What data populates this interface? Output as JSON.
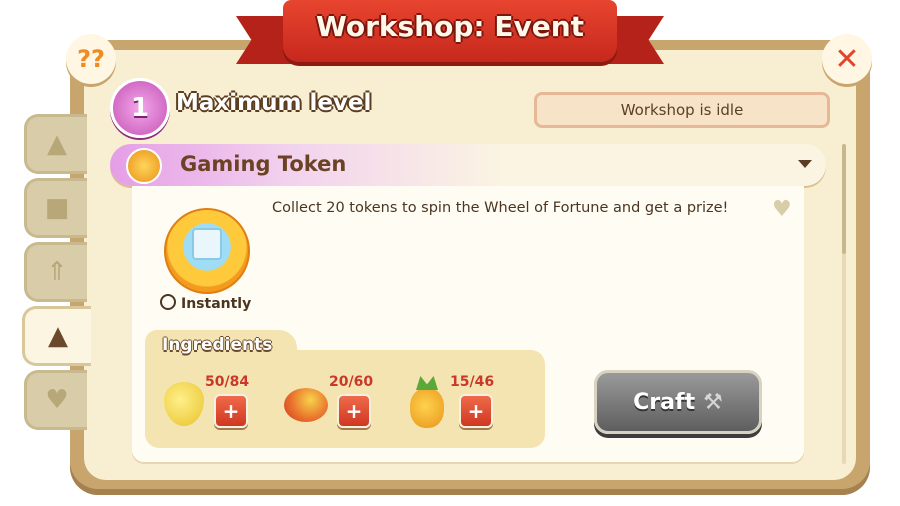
{
  "header": {
    "title": "Workshop: Event"
  },
  "buttons": {
    "help_glyph": "??",
    "close_glyph": "✕"
  },
  "level": {
    "number": "1",
    "label": "Maximum level"
  },
  "status": {
    "text": "Workshop is idle"
  },
  "item": {
    "name": "Gaming Token",
    "description": "Collect 20 tokens to spin the Wheel of Fortune and get a prize!",
    "time_label": "Instantly"
  },
  "ingredients": {
    "label": "Ingredients",
    "items": [
      {
        "icon": "pear-icon",
        "count": "50/84",
        "color": "#f3d24a"
      },
      {
        "icon": "mango-icon",
        "count": "20/60",
        "color": "#e86a2b"
      },
      {
        "icon": "pineapple-icon",
        "count": "15/46",
        "color": "#f2a41f"
      }
    ],
    "plus_glyph": "+"
  },
  "craft": {
    "label": "Craft"
  },
  "side_tabs": [
    {
      "icon": "lamp-icon",
      "active": false
    },
    {
      "icon": "chest-icon",
      "active": false
    },
    {
      "icon": "upgrade-arrows-icon",
      "active": false
    },
    {
      "icon": "party-hat-icon",
      "active": true
    },
    {
      "icon": "heart-icon",
      "active": false
    }
  ],
  "colors": {
    "panel": "#c9a56e",
    "accent_red": "#e7452f",
    "level_badge": "#c452b4"
  }
}
